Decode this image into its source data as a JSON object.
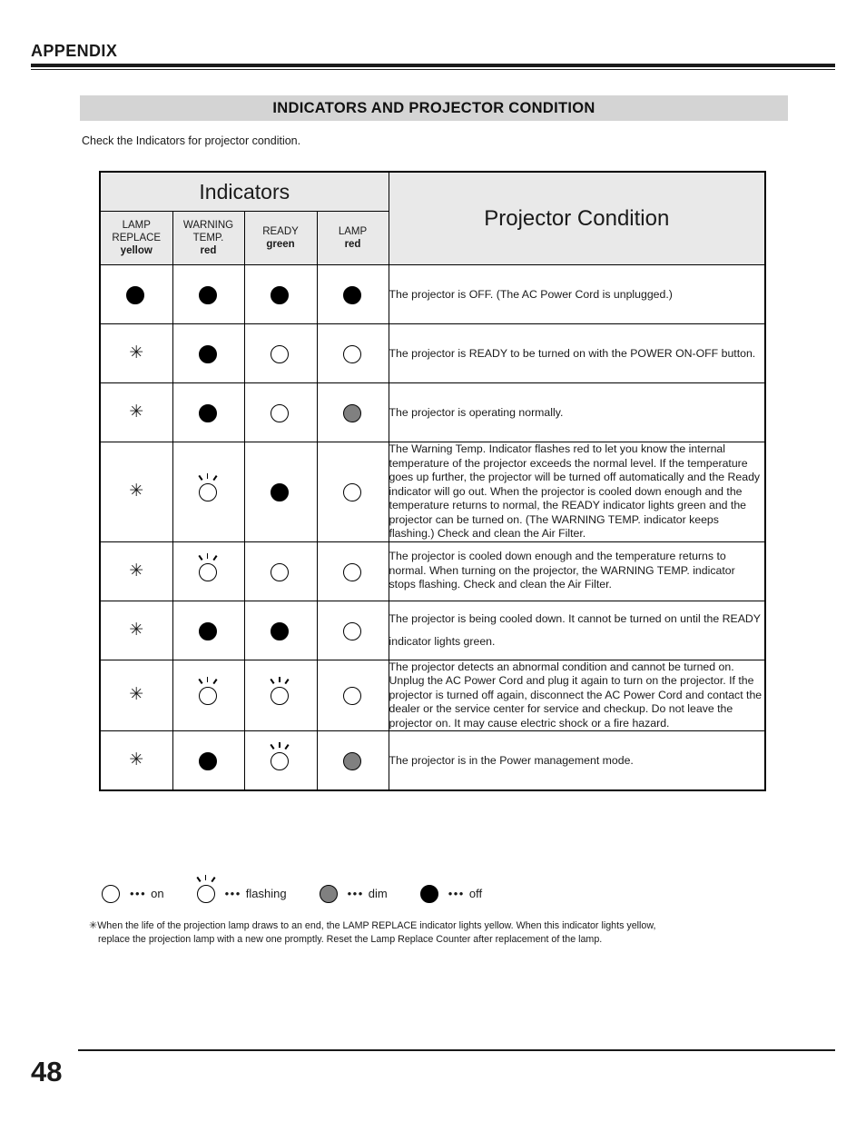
{
  "header": {
    "running_head": "APPENDIX"
  },
  "section": {
    "banner_title": "INDICATORS AND PROJECTOR CONDITION",
    "intro": "Check the Indicators for projector condition."
  },
  "table": {
    "group_header": "Indicators",
    "condition_header": "Projector Condition",
    "columns": [
      {
        "name": "LAMP REPLACE",
        "name_line1": "LAMP",
        "name_line2": "REPLACE",
        "color": "yellow"
      },
      {
        "name": "WARNING TEMP.",
        "name_line1": "WARNING",
        "name_line2": "TEMP.",
        "color": "red"
      },
      {
        "name": "READY",
        "name_line1": "READY",
        "name_line2": "",
        "color": "green"
      },
      {
        "name": "LAMP",
        "name_line1": "LAMP",
        "name_line2": "",
        "color": "red"
      }
    ],
    "rows": [
      {
        "lamp_replace": "off",
        "warning_temp": "off",
        "ready": "off",
        "lamp": "off",
        "condition": "The projector is OFF.  (The AC Power Cord is unplugged.)",
        "spacing": "loose"
      },
      {
        "lamp_replace": "asterisk",
        "warning_temp": "off",
        "ready": "on",
        "lamp": "on",
        "condition": "The projector is READY to be turned on with the POWER ON-OFF button.",
        "spacing": "loose"
      },
      {
        "lamp_replace": "asterisk",
        "warning_temp": "off",
        "ready": "on",
        "lamp": "dim",
        "condition": "The projector is operating normally.",
        "spacing": "loose"
      },
      {
        "lamp_replace": "asterisk",
        "warning_temp": "flashing",
        "ready": "off",
        "lamp": "on",
        "condition": "The Warning Temp. Indicator flashes red to let you know the internal temperature of the projector exceeds the normal level. If the temperature goes up further, the projector will be turned off automatically and the Ready indicator will go out.  When  the projector is cooled down enough and the temperature returns to normal, the READY indicator lights green and the projector can be turned on.  (The WARNING TEMP. indicator keeps flashing.) Check and clean the Air Filter.",
        "spacing": "tight"
      },
      {
        "lamp_replace": "asterisk",
        "warning_temp": "flashing",
        "ready": "on",
        "lamp": "on",
        "condition": "The projector is cooled down enough and the temperature returns to normal.  When turning on the projector, the WARNING TEMP. indicator stops flashing.  Check and clean the Air Filter.",
        "spacing": "tight"
      },
      {
        "lamp_replace": "asterisk",
        "warning_temp": "off",
        "ready": "off",
        "lamp": "on",
        "condition": "The projector is being cooled down. It cannot be turned on until the READY indicator lights green.",
        "spacing": "loose"
      },
      {
        "lamp_replace": "asterisk",
        "warning_temp": "flashing",
        "ready": "flashing",
        "lamp": "on",
        "condition": "The projector detects an abnormal condition and cannot be turned on.  Unplug the AC Power Cord and plug it again to turn on the projector.  If the projector is turned off again, disconnect the AC Power Cord and contact the dealer or the service center for service and checkup.  Do not leave the projector on.  It may cause electric shock or a fire hazard.",
        "spacing": "tight"
      },
      {
        "lamp_replace": "asterisk",
        "warning_temp": "off",
        "ready": "flashing",
        "lamp": "dim",
        "condition": "The projector is in the Power management mode.",
        "spacing": "loose"
      }
    ]
  },
  "legend": {
    "dots": "•••",
    "items": [
      {
        "symbol": "on",
        "label": "on"
      },
      {
        "symbol": "flashing",
        "label": "flashing"
      },
      {
        "symbol": "dim",
        "label": "dim"
      },
      {
        "symbol": "off",
        "label": "off"
      }
    ]
  },
  "footnote": {
    "mark": "✳",
    "line1": "When the life of the projection lamp draws to an end, the LAMP REPLACE indicator lights yellow.  When this indicator lights yellow,",
    "line2": "replace the projection lamp with a new one promptly.  Reset the Lamp Replace Counter after replacement of the lamp."
  },
  "footer": {
    "page_number": "48"
  },
  "colors": {
    "banner_bg": "#d4d4d4",
    "table_header_bg": "#e9e9e9",
    "ink": "#1a1a1a",
    "dim_gray": "#808080"
  }
}
